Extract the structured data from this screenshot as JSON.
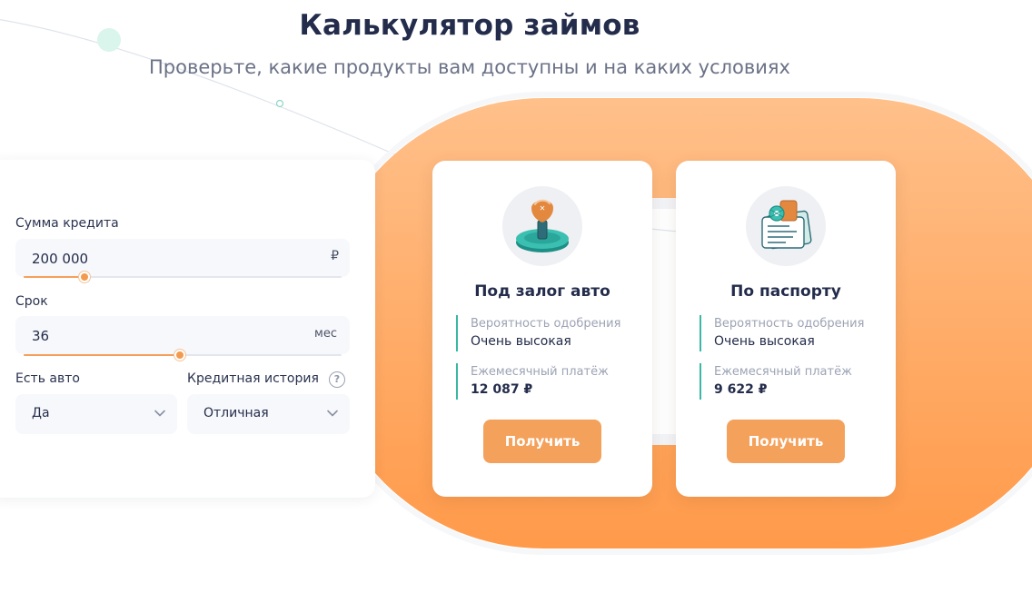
{
  "header": {
    "title": "Калькулятор займов",
    "subtitle": "Проверьте, какие продукты вам доступны и на каких условиях"
  },
  "form": {
    "amount": {
      "label": "Сумма кредита",
      "value": "200 000",
      "unit": "₽",
      "slider_fraction": 0.19
    },
    "term": {
      "label": "Срок",
      "value": "36",
      "unit": "мес",
      "slider_fraction": 0.49
    },
    "car": {
      "label": "Есть авто",
      "value": "Да"
    },
    "credit_history": {
      "label": "Кредитная история",
      "value": "Отличная",
      "help_glyph": "?"
    }
  },
  "products": [
    {
      "title": "Под залог авто",
      "icon": "gear-shift-icon",
      "approval_label": "Вероятность одобрения",
      "approval_value": "Очень высокая",
      "payment_label": "Ежемесячный платёж",
      "payment_value": "12 087 ₽",
      "button_label": "Получить"
    },
    {
      "title": "По паспорту",
      "icon": "passport-document-icon",
      "approval_label": "Вероятность одобрения",
      "approval_value": "Очень высокая",
      "payment_label": "Ежемесячный платёж",
      "payment_value": "9 622 ₽",
      "button_label": "Получить"
    }
  ],
  "colors": {
    "accent_orange": "#f4a15c",
    "stat_border_teal": "#3bb8a4",
    "title_navy": "#232c4b"
  }
}
